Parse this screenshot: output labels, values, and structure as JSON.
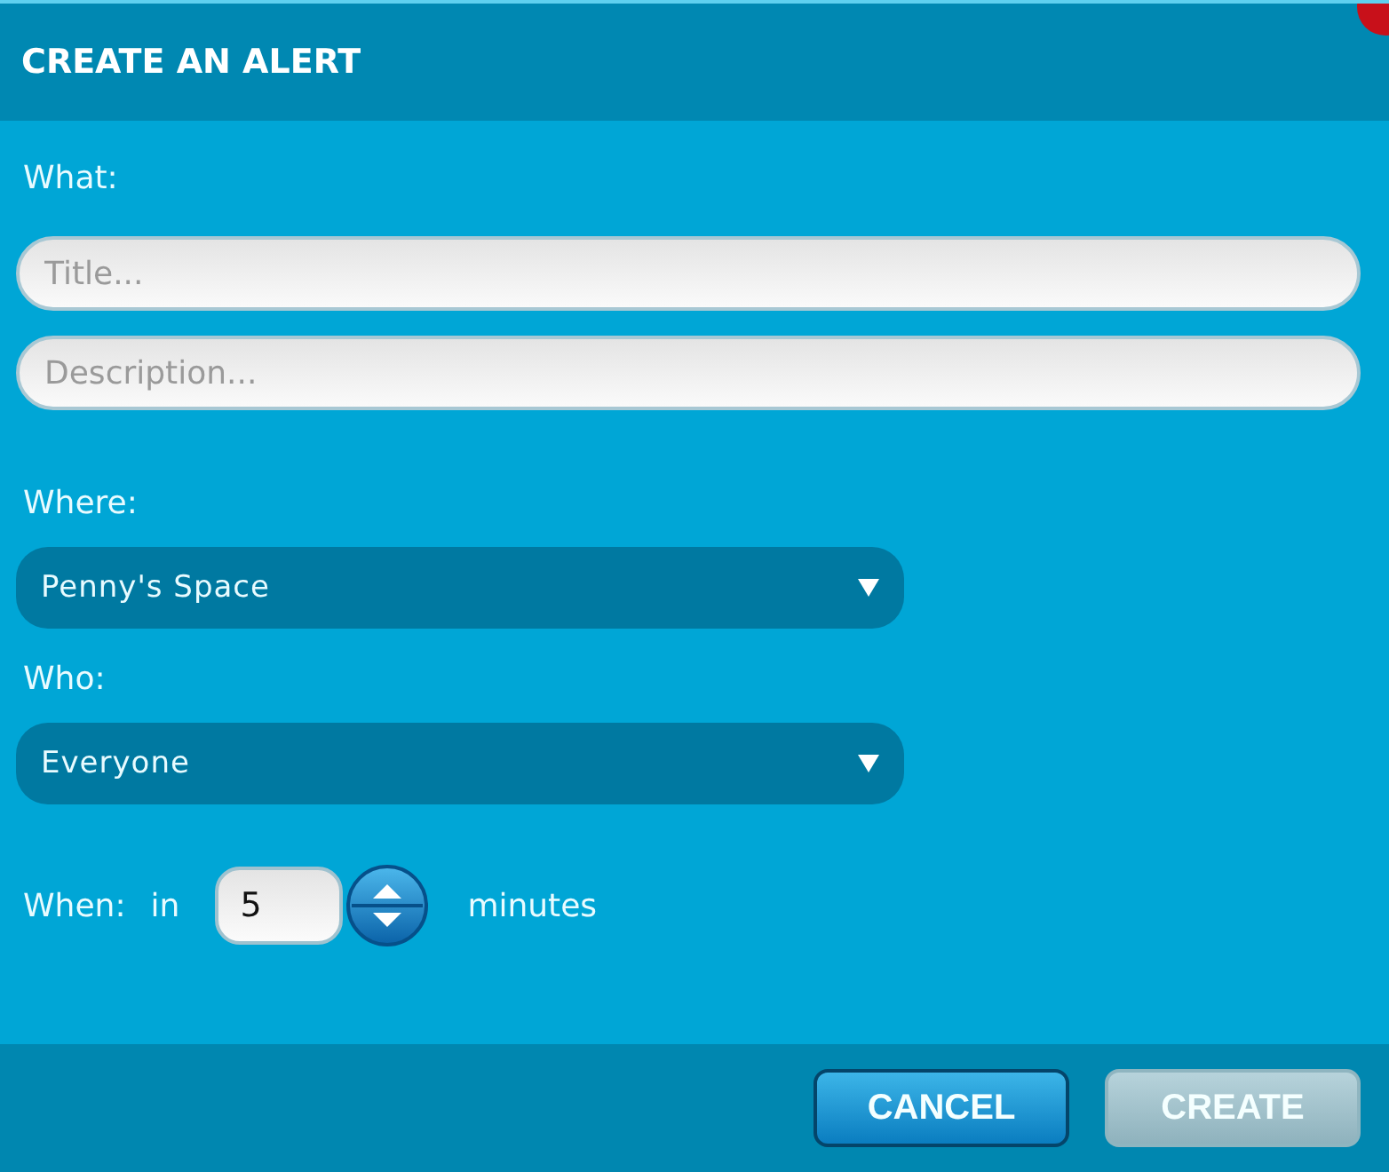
{
  "dialog": {
    "title": "CREATE AN ALERT"
  },
  "what": {
    "label": "What:",
    "title_field": {
      "placeholder": "Title..."
    },
    "description_field": {
      "placeholder": "Description..."
    }
  },
  "where": {
    "label": "Where:",
    "value": "Penny's Space"
  },
  "who": {
    "label": "Who:",
    "value": "Everyone"
  },
  "when": {
    "label": "When:",
    "prefix": "in",
    "value": "5",
    "suffix": "minutes"
  },
  "buttons": [
    {
      "label": "CANCEL",
      "kind": "secondary",
      "disabled": false
    },
    {
      "label": "CREATE",
      "kind": "primary",
      "disabled": true
    }
  ]
}
